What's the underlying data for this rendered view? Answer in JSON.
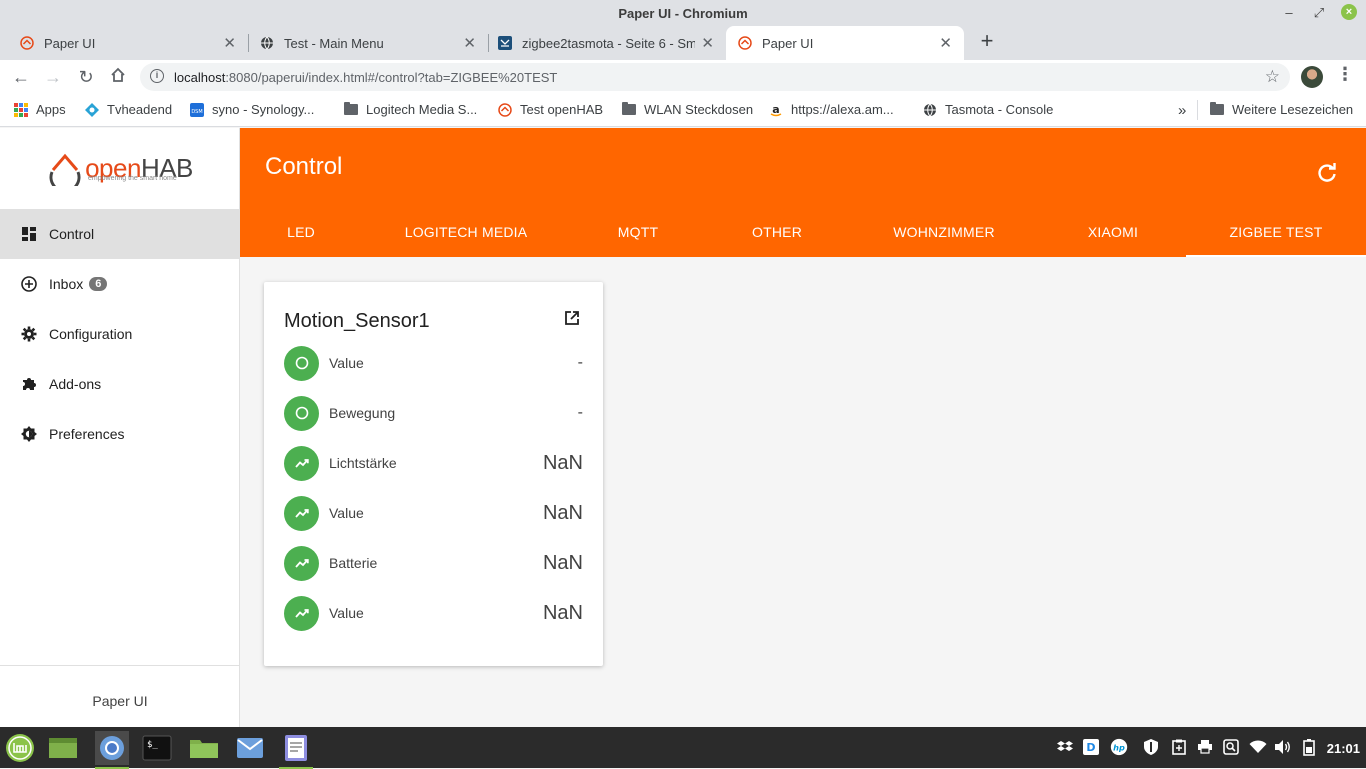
{
  "window": {
    "title": "Paper UI - Chromium"
  },
  "browser_tabs": [
    {
      "title": "Paper UI"
    },
    {
      "title": "Test - Main Menu"
    },
    {
      "title": "zigbee2tasmota - Seite 6 - Sm"
    },
    {
      "title": "Paper UI"
    }
  ],
  "address": {
    "host": "localhost",
    "path": ":8080/paperui/index.html#/control?tab=ZIGBEE%20TEST"
  },
  "bookmarks": {
    "apps": "Apps",
    "items": [
      "Tvheadend",
      "syno - Synology...",
      "Logitech Media S...",
      "Test openHAB",
      "WLAN Steckdosen",
      "https://alexa.am...",
      "Tasmota - Console"
    ],
    "overflow": "»",
    "other": "Weitere Lesezeichen"
  },
  "app": {
    "logo_name_a": "open",
    "logo_name_b": "HAB",
    "logo_tagline": "empowering the smart home",
    "page_title": "Control",
    "footer": "Paper UI"
  },
  "sidebar": {
    "items": [
      {
        "label": "Control"
      },
      {
        "label": "Inbox",
        "badge": "6"
      },
      {
        "label": "Configuration"
      },
      {
        "label": "Add-ons"
      },
      {
        "label": "Preferences"
      }
    ]
  },
  "control_tabs": [
    "LED",
    "LOGITECH MEDIA",
    "MQTT",
    "OTHER",
    "WOHNZIMMER",
    "XIAOMI",
    "ZIGBEE TEST"
  ],
  "selected_tab": "ZIGBEE TEST",
  "card": {
    "title": "Motion_Sensor1",
    "items": [
      {
        "label": "Value",
        "value": "-",
        "icon": "circle-icon"
      },
      {
        "label": "Bewegung",
        "value": "-",
        "icon": "circle-icon"
      },
      {
        "label": "Lichtstärke",
        "value": "NaN",
        "icon": "trending-up-icon"
      },
      {
        "label": "Value",
        "value": "NaN",
        "icon": "trending-up-icon"
      },
      {
        "label": "Batterie",
        "value": "NaN",
        "icon": "trending-up-icon"
      },
      {
        "label": "Value",
        "value": "NaN",
        "icon": "trending-up-icon"
      }
    ]
  },
  "taskbar": {
    "clock": "21:01"
  },
  "colors": {
    "accent": "#ff6600",
    "item_icon_bg": "#4caf50",
    "mint": "#8bc34a"
  }
}
